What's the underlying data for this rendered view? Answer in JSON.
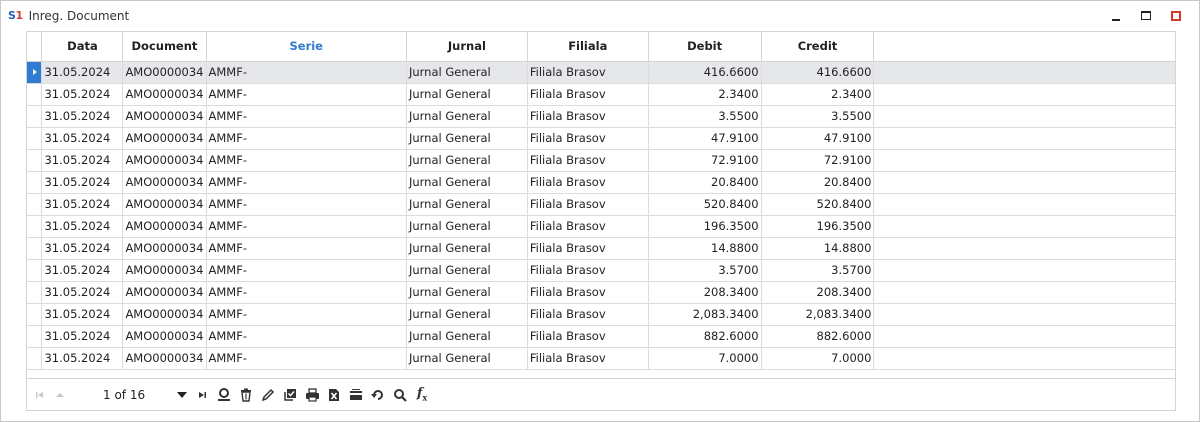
{
  "window": {
    "logo_s": "S",
    "logo_one": "1",
    "title": "Inreg. Document"
  },
  "grid": {
    "columns": [
      "Data",
      "Document",
      "Serie",
      "Jurnal",
      "Filiala",
      "Debit",
      "Credit"
    ],
    "sorted_column": "Serie",
    "rows": [
      [
        "31.05.2024",
        "AMO0000034",
        "AMMF-",
        "Jurnal General",
        "Filiala Brasov",
        "416.6600",
        "416.6600"
      ],
      [
        "31.05.2024",
        "AMO0000034",
        "AMMF-",
        "Jurnal General",
        "Filiala Brasov",
        "2.3400",
        "2.3400"
      ],
      [
        "31.05.2024",
        "AMO0000034",
        "AMMF-",
        "Jurnal General",
        "Filiala Brasov",
        "3.5500",
        "3.5500"
      ],
      [
        "31.05.2024",
        "AMO0000034",
        "AMMF-",
        "Jurnal General",
        "Filiala Brasov",
        "47.9100",
        "47.9100"
      ],
      [
        "31.05.2024",
        "AMO0000034",
        "AMMF-",
        "Jurnal General",
        "Filiala Brasov",
        "72.9100",
        "72.9100"
      ],
      [
        "31.05.2024",
        "AMO0000034",
        "AMMF-",
        "Jurnal General",
        "Filiala Brasov",
        "20.8400",
        "20.8400"
      ],
      [
        "31.05.2024",
        "AMO0000034",
        "AMMF-",
        "Jurnal General",
        "Filiala Brasov",
        "520.8400",
        "520.8400"
      ],
      [
        "31.05.2024",
        "AMO0000034",
        "AMMF-",
        "Jurnal General",
        "Filiala Brasov",
        "196.3500",
        "196.3500"
      ],
      [
        "31.05.2024",
        "AMO0000034",
        "AMMF-",
        "Jurnal General",
        "Filiala Brasov",
        "14.8800",
        "14.8800"
      ],
      [
        "31.05.2024",
        "AMO0000034",
        "AMMF-",
        "Jurnal General",
        "Filiala Brasov",
        "3.5700",
        "3.5700"
      ],
      [
        "31.05.2024",
        "AMO0000034",
        "AMMF-",
        "Jurnal General",
        "Filiala Brasov",
        "208.3400",
        "208.3400"
      ],
      [
        "31.05.2024",
        "AMO0000034",
        "AMMF-",
        "Jurnal General",
        "Filiala Brasov",
        "2,083.3400",
        "2,083.3400"
      ],
      [
        "31.05.2024",
        "AMO0000034",
        "AMMF-",
        "Jurnal General",
        "Filiala Brasov",
        "882.6000",
        "882.6000"
      ],
      [
        "31.05.2024",
        "AMO0000034",
        "AMMF-",
        "Jurnal General",
        "Filiala Brasov",
        "7.0000",
        "7.0000"
      ]
    ]
  },
  "pager": {
    "page_info": "1 of 16",
    "tools": [
      "first-page-icon",
      "prev-page-icon",
      "page-dropdown-icon",
      "last-page-icon",
      "add-record-icon",
      "delete-icon",
      "edit-icon",
      "select-all-icon",
      "print-icon",
      "export-excel-icon",
      "group-icon",
      "refresh-icon",
      "search-icon",
      "formula-icon"
    ]
  },
  "colors": {
    "accent": "#2f7bd0",
    "close": "#d23b2b",
    "selected_row": "#e6e7eb"
  }
}
